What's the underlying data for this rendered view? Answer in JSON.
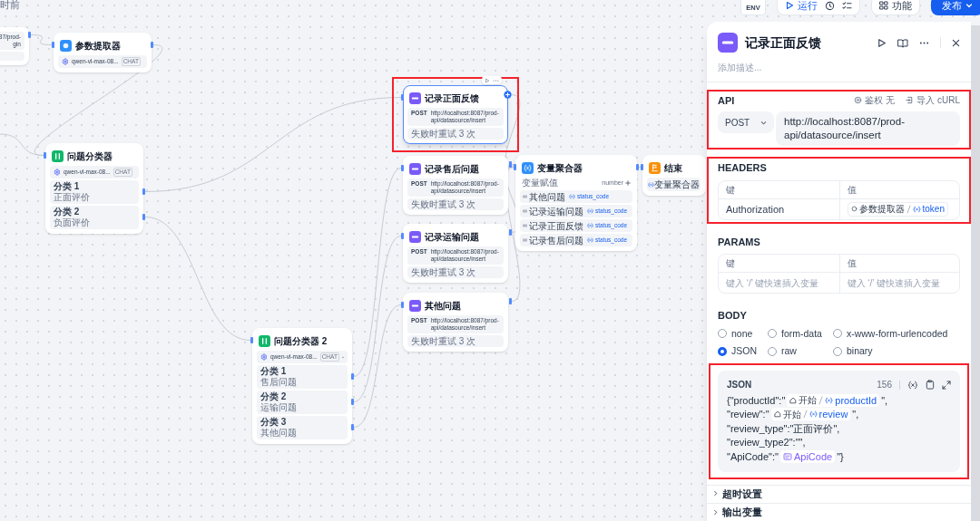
{
  "canvas": {
    "timestamp": "时前",
    "nodes": [
      {
        "kind": "partial",
        "lines": [
          "87/prod-",
          "gin"
        ],
        "selected": false,
        "highlighted": false
      },
      {
        "kind": "llm",
        "title": "参数提取器",
        "model": "qwen-vl-max-08...",
        "badge": "CHAT",
        "selected": false,
        "highlighted": false
      },
      {
        "kind": "classifier",
        "title": "问题分类器",
        "model": "qwen-vl-max-08...",
        "badge": "CHAT",
        "classes": [
          {
            "label": "分类 1",
            "value": "正面评价"
          },
          {
            "label": "分类 2",
            "value": "负面评价"
          }
        ],
        "selected": false,
        "highlighted": false
      },
      {
        "kind": "http",
        "title": "记录正面反馈",
        "method": "POST",
        "url": "http://localhost:8087/prod-api/datasource/insert",
        "retry": "失败时重试 3 次",
        "selected": true,
        "highlighted": true
      },
      {
        "kind": "http",
        "title": "记录售后问题",
        "method": "POST",
        "url": "http://localhost:8087/prod-api/datasource/insert",
        "retry": "失败时重试 3 次",
        "selected": false,
        "highlighted": false
      },
      {
        "kind": "http",
        "title": "记录运输问题",
        "method": "POST",
        "url": "http://localhost:8087/prod-api/datasource/insert",
        "retry": "失败时重试 3 次",
        "selected": false,
        "highlighted": false
      },
      {
        "kind": "http",
        "title": "其他问题",
        "method": "POST",
        "url": "http://localhost:8087/prod-api/datasource/insert",
        "retry": "失败时重试 3 次",
        "selected": false,
        "highlighted": false
      },
      {
        "kind": "aggregator",
        "title": "变量聚合器",
        "header": "变量赋值",
        "type": "number",
        "rows": [
          {
            "node": "其他问题",
            "var": "status_code"
          },
          {
            "node": "记录运输问题",
            "var": "status_code"
          },
          {
            "node": "记录正面反馈",
            "var": "status_code"
          },
          {
            "node": "记录售后问题",
            "var": "status_code"
          }
        ],
        "selected": false,
        "highlighted": false
      },
      {
        "kind": "end",
        "title": "结束",
        "output": "变量聚合器",
        "selected": false,
        "highlighted": false
      },
      {
        "kind": "classifier",
        "title": "问题分类器 2",
        "model": "qwen-vl-max-08...",
        "badge": "CHAT",
        "classes": [
          {
            "label": "分类 1",
            "value": "售后问题"
          },
          {
            "label": "分类 2",
            "value": "运输问题"
          },
          {
            "label": "分类 3",
            "value": "其他问题"
          }
        ],
        "selected": false,
        "highlighted": false
      }
    ]
  },
  "toolbar": {
    "env": "ENV",
    "run": "运行",
    "features": "功能",
    "publish": "发布"
  },
  "panel": {
    "title": "记录正面反馈",
    "description": {
      "placeholder": "添加描述..."
    },
    "api": {
      "label": "API",
      "auth": "鉴权 无",
      "import": "导入 cURL",
      "method": "POST",
      "url": "http://localhost:8087/prod-api/datasource/insert",
      "highlighted": true
    },
    "headers": {
      "label": "HEADERS",
      "columns": [
        "键",
        "值"
      ],
      "rows": [
        {
          "key": "Authorization",
          "node": "参数提取器",
          "var": "token"
        }
      ],
      "highlighted": true
    },
    "params": {
      "label": "PARAMS",
      "columns": [
        "键",
        "值"
      ],
      "placeholders": [
        "键入 ‘/’ 键快速插入变量",
        "键入 ‘/’ 键快速插入变量"
      ],
      "highlighted": false
    },
    "body": {
      "label": "BODY",
      "options": [
        {
          "label": "none",
          "selected": false
        },
        {
          "label": "form-data",
          "selected": false
        },
        {
          "label": "x-www-form-urlencoded",
          "selected": false
        },
        {
          "label": "JSON",
          "selected": true
        },
        {
          "label": "raw",
          "selected": false
        },
        {
          "label": "binary",
          "selected": false
        }
      ],
      "editor": {
        "label": "JSON",
        "count": "156",
        "highlighted": true,
        "lines": [
          [
            {
              "kind": "text",
              "text": "{\"productId\":\""
            },
            {
              "kind": "var",
              "node": "开始",
              "name": "productId"
            },
            {
              "kind": "text",
              "text": "\","
            }
          ],
          [
            {
              "kind": "text",
              "text": "\"review\":\""
            },
            {
              "kind": "var",
              "node": "开始",
              "name": "review"
            },
            {
              "kind": "text",
              "text": "\","
            }
          ],
          [
            {
              "kind": "text",
              "text": "\"review_type\":\"正面评价\","
            }
          ],
          [
            {
              "kind": "text",
              "text": "\"review_type2\":\"\","
            }
          ],
          [
            {
              "kind": "text",
              "text": "\"ApiCode\":\""
            },
            {
              "kind": "env",
              "name": "ApiCode"
            },
            {
              "kind": "text",
              "text": "\"}"
            }
          ]
        ]
      }
    },
    "sections": [
      {
        "label": "超时设置",
        "expanded": false
      },
      {
        "label": "输出变量",
        "expanded": false
      }
    ]
  }
}
